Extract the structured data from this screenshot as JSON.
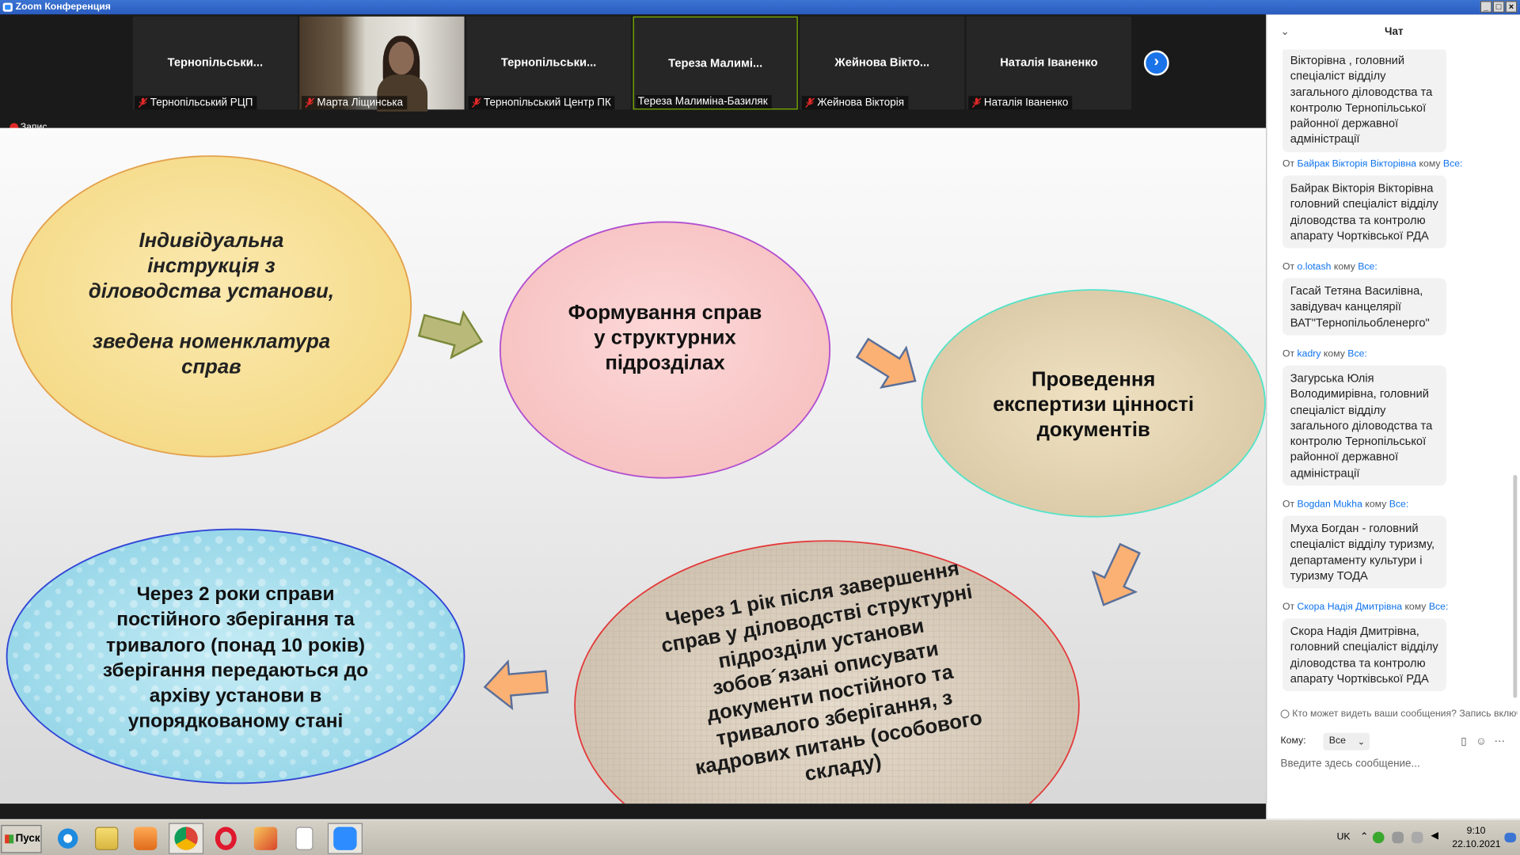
{
  "window": {
    "title": "Zoom Конференция"
  },
  "participants": [
    {
      "name": "Тернопільськи...",
      "label": "Тернопільський РЦП"
    },
    {
      "name": "",
      "label": "Марта Ліщинська"
    },
    {
      "name": "Тернопільськи...",
      "label": "Тернопільський Центр ПК"
    },
    {
      "name": "Тереза Малимі...",
      "label": "Тереза Малиміна-Базиляк"
    },
    {
      "name": "Жейнова Вікто...",
      "label": "Жейнова Вікторія"
    },
    {
      "name": "Наталія Іваненко",
      "label": "Наталія Іваненко"
    }
  ],
  "recording": "Запис",
  "slide": {
    "oval1": [
      "Індивідуальна",
      "інструкція з",
      "діловодства установи,",
      "",
      "зведена номенклатура",
      "справ"
    ],
    "oval2": [
      "Формування справ",
      "у структурних",
      "підрозділах"
    ],
    "oval3": [
      "Проведення",
      "експертизи цінності",
      "документів"
    ],
    "oval4": [
      "Через 1 рік після завершення",
      "справ у діловодстві структурні",
      "підрозділи установи",
      "зобов´язані описувати",
      "документи постійного та",
      "тривалого зберігання, з",
      "кадрових питань (особового",
      "складу)"
    ],
    "oval5": [
      "Через 2 роки справи",
      "постійного зберігання та",
      "тривалого (понад 10 років)",
      "зберігання передаються до",
      "архіву установи в",
      "упорядкованому стані"
    ]
  },
  "chat": {
    "title": "Чат",
    "messages": [
      {
        "from": "",
        "to": "",
        "text": "Вікторівна , головний спеціаліст відділу загального діловодства та контролю Тернопільської районної державної адміністрації"
      },
      {
        "from": "Байрак Вікторія Вікторівна",
        "to": "Все:",
        "text": "Байрак Вікторія Вікторівна головний спеціаліст відділу діловодства та контролю апарату Чортківської РДА"
      },
      {
        "from": "o.lotash",
        "to": "Все:",
        "text": "Гасай Тетяна Василівна, завідувач канцелярії ВАТ\"Тернопільобленерго\""
      },
      {
        "from": "kadry",
        "to": "Все:",
        "text": "Загурська Юлія Володимирівна, головний спеціаліст відділу загального діловодства  та контролю Тернопільської районної державної адміністрації"
      },
      {
        "from": "Bogdan Mukha",
        "to": "Все:",
        "text": "Муха Богдан - головний спеціаліст відділу туризму, департаменту культури і туризму ТОДА"
      },
      {
        "from": "Скора Надія Дмитрівна",
        "to": "Все:",
        "text": "Скора Надія Дмитрівна, головний спеціаліст відділу діловодства та контролю апарату Чортківської РДА"
      }
    ],
    "from_prefix": "От",
    "to_word": "кому",
    "notice": "Кто может видеть ваши сообщения? Запись включена",
    "to_label": "Кому:",
    "to_value": "Все",
    "placeholder": "Введите здесь сообщение..."
  },
  "taskbar": {
    "start": "Пуск",
    "lang": "UK",
    "time": "9:10",
    "date": "22.10.2021"
  }
}
